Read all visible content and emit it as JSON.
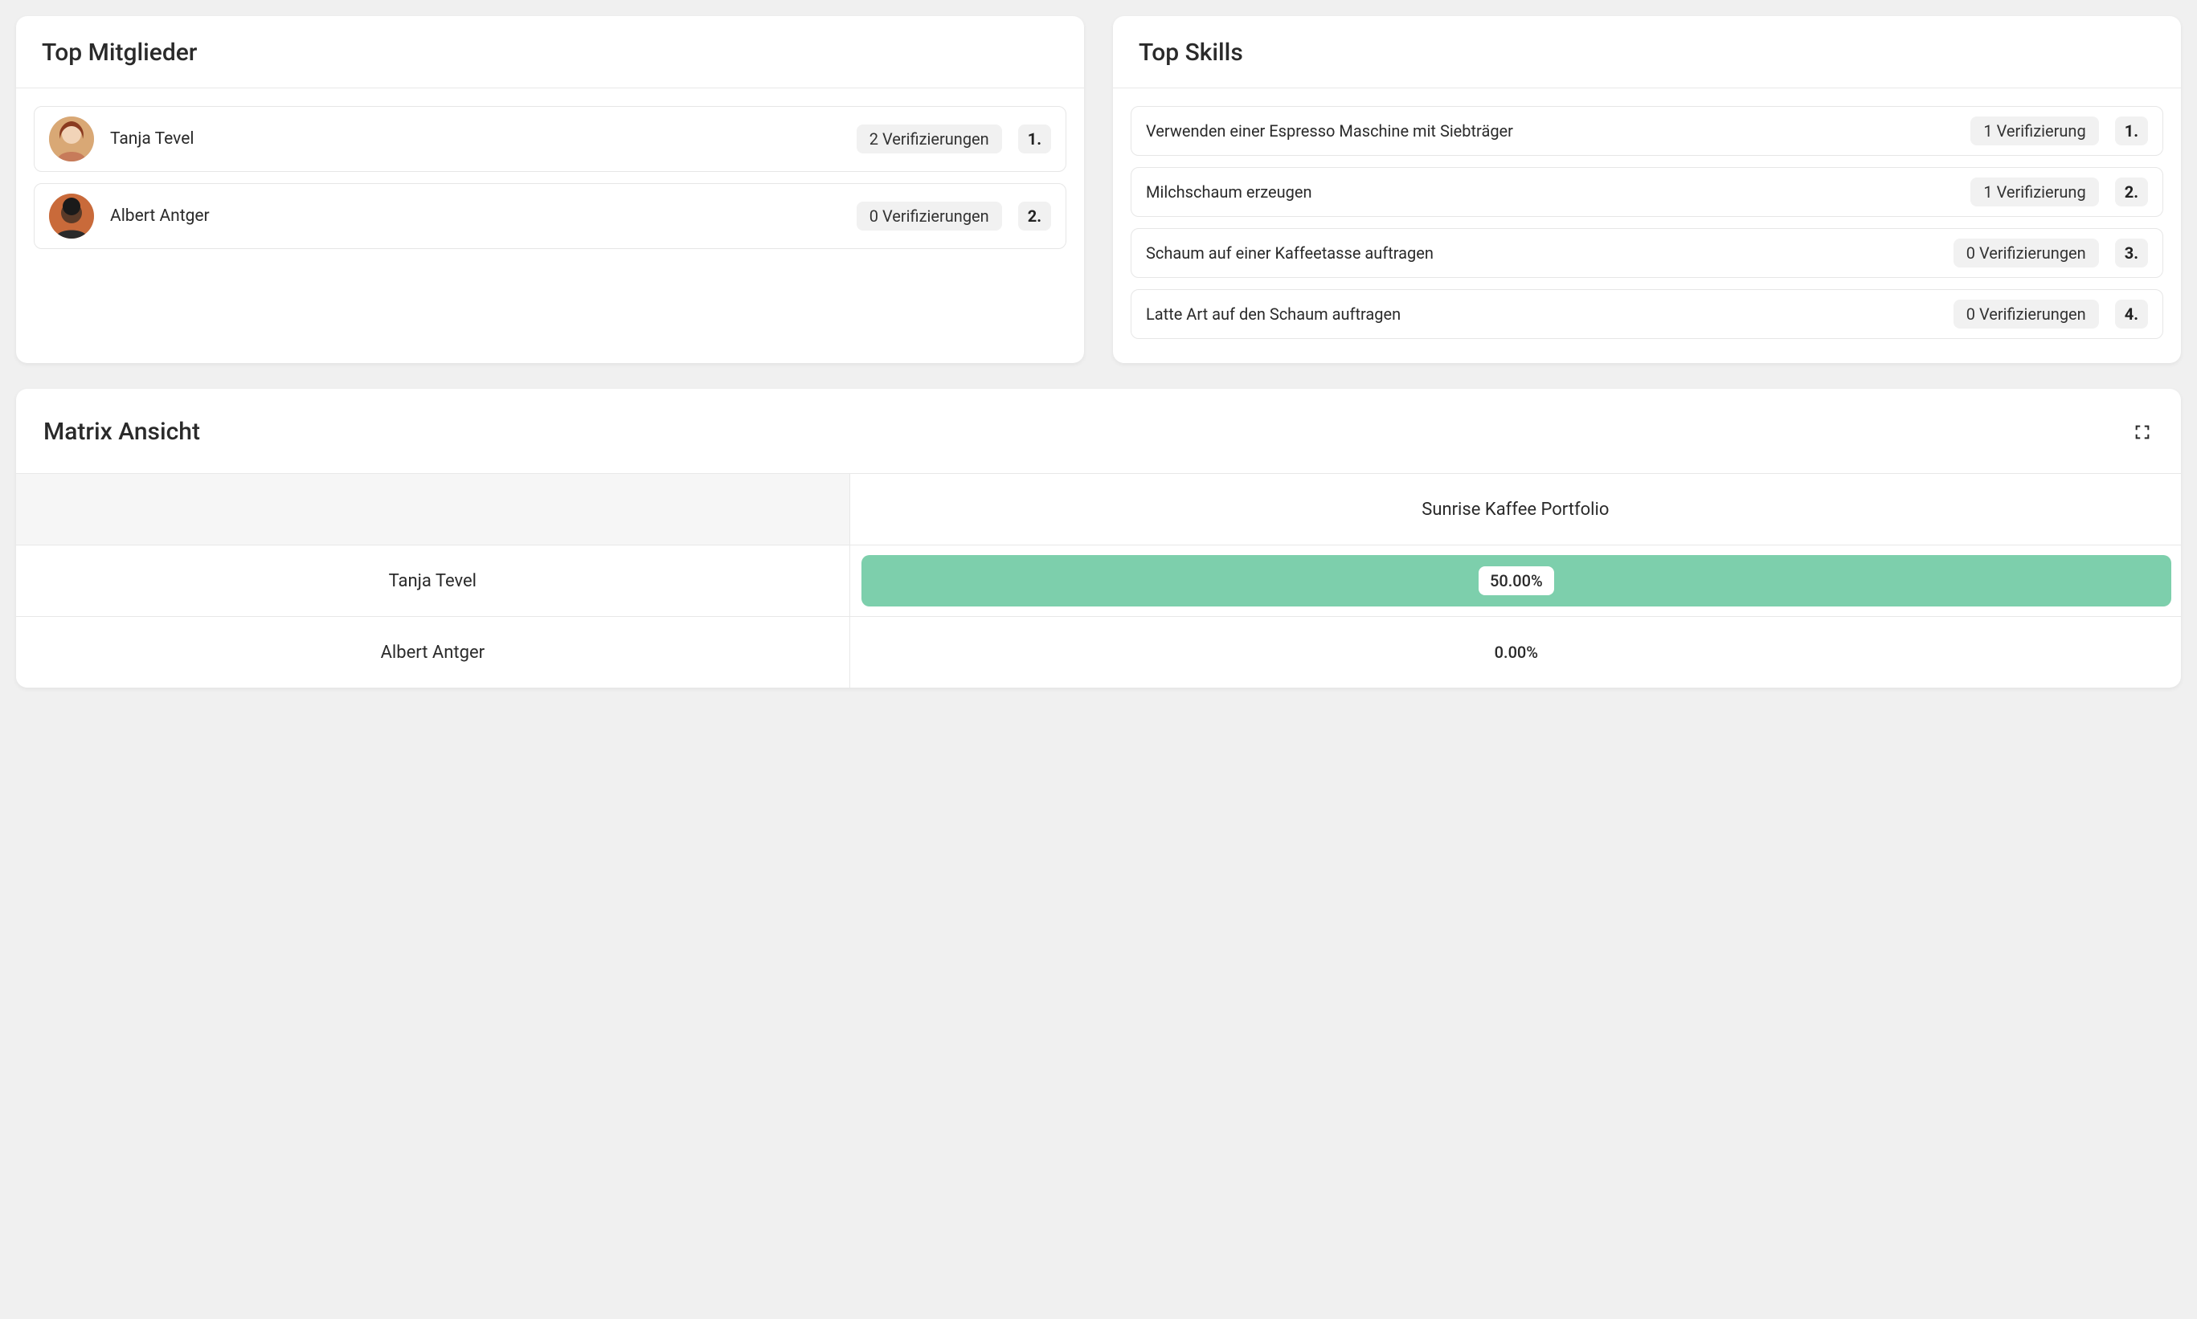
{
  "top_members": {
    "title": "Top Mitglieder",
    "items": [
      {
        "name": "Tanja Tevel",
        "verif_label": "2 Verifizierungen",
        "rank": "1.",
        "avatar_type": "a"
      },
      {
        "name": "Albert Antger",
        "verif_label": "0 Verifizierungen",
        "rank": "2.",
        "avatar_type": "b"
      }
    ]
  },
  "top_skills": {
    "title": "Top Skills",
    "items": [
      {
        "name": "Verwenden einer Espresso Maschine mit Siebträger",
        "verif_label": "1 Verifizierung",
        "rank": "1."
      },
      {
        "name": "Milchschaum erzeugen",
        "verif_label": "1 Verifizierung",
        "rank": "2."
      },
      {
        "name": "Schaum auf einer Kaffeetasse auftragen",
        "verif_label": "0 Verifizierungen",
        "rank": "3."
      },
      {
        "name": "Latte Art auf den Schaum auftragen",
        "verif_label": "0 Verifizierungen",
        "rank": "4."
      }
    ]
  },
  "matrix": {
    "title": "Matrix Ansicht",
    "column_header": "Sunrise Kaffee Portfolio",
    "rows": [
      {
        "name": "Tanja Tevel",
        "value": "50.00%",
        "filled": true
      },
      {
        "name": "Albert Antger",
        "value": "0.00%",
        "filled": false
      }
    ]
  }
}
